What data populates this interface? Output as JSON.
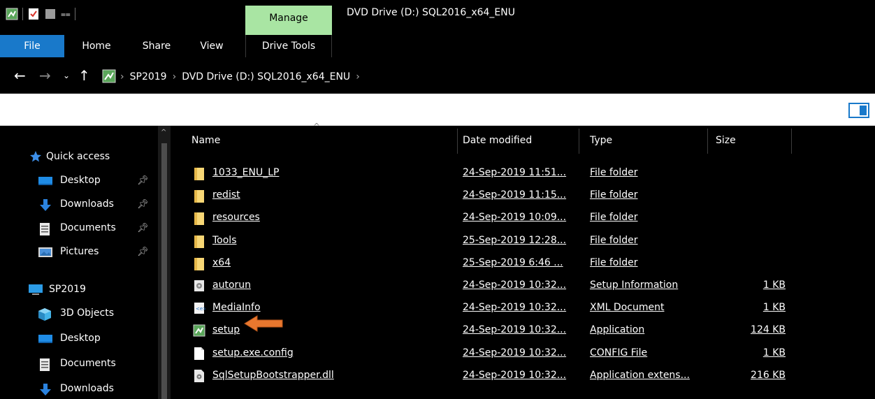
{
  "window": {
    "title": "DVD Drive (D:) SQL2016_x64_ENU",
    "contextual_tab_group": "Manage"
  },
  "ribbon": {
    "tabs": [
      "File",
      "Home",
      "Share",
      "View",
      "Drive Tools"
    ]
  },
  "address": {
    "crumbs": [
      "SP2019",
      "DVD Drive (D:) SQL2016_x64_ENU"
    ]
  },
  "nav_pane": {
    "items": [
      {
        "label": "Quick access",
        "icon": "star-icon"
      },
      {
        "label": "Desktop",
        "icon": "desktop-icon",
        "pinned": true
      },
      {
        "label": "Downloads",
        "icon": "download-icon",
        "pinned": true
      },
      {
        "label": "Documents",
        "icon": "documents-icon",
        "pinned": true
      },
      {
        "label": "Pictures",
        "icon": "pictures-icon",
        "pinned": true
      },
      {
        "label": "SP2019",
        "icon": "computer-icon"
      },
      {
        "label": "3D Objects",
        "icon": "3d-objects-icon"
      },
      {
        "label": "Desktop",
        "icon": "desktop-icon"
      },
      {
        "label": "Documents",
        "icon": "documents-icon"
      },
      {
        "label": "Downloads",
        "icon": "download-icon"
      }
    ]
  },
  "columns": {
    "name": "Name",
    "date": "Date modified",
    "type": "Type",
    "size": "Size"
  },
  "files": [
    {
      "name": "1033_ENU_LP",
      "date": "24-Sep-2019 11:51...",
      "type": "File folder",
      "size": "",
      "icon": "folder-icon"
    },
    {
      "name": "redist",
      "date": "24-Sep-2019 11:15...",
      "type": "File folder",
      "size": "",
      "icon": "folder-icon"
    },
    {
      "name": "resources",
      "date": "24-Sep-2019 10:09...",
      "type": "File folder",
      "size": "",
      "icon": "folder-icon"
    },
    {
      "name": "Tools",
      "date": "25-Sep-2019 12:28...",
      "type": "File folder",
      "size": "",
      "icon": "folder-icon"
    },
    {
      "name": "x64",
      "date": "25-Sep-2019 6:46 ...",
      "type": "File folder",
      "size": "",
      "icon": "folder-icon"
    },
    {
      "name": "autorun",
      "date": "24-Sep-2019 10:32...",
      "type": "Setup Information",
      "size": "1 KB",
      "icon": "setup-info-icon"
    },
    {
      "name": "MediaInfo",
      "date": "24-Sep-2019 10:32...",
      "type": "XML Document",
      "size": "1 KB",
      "icon": "xml-document-icon"
    },
    {
      "name": "setup",
      "date": "24-Sep-2019 10:32...",
      "type": "Application",
      "size": "124 KB",
      "icon": "application-icon"
    },
    {
      "name": "setup.exe.config",
      "date": "24-Sep-2019 10:32...",
      "type": "CONFIG File",
      "size": "1 KB",
      "icon": "file-icon"
    },
    {
      "name": "SqlSetupBootstrapper.dll",
      "date": "24-Sep-2019 10:32...",
      "type": "Application extens...",
      "size": "216 KB",
      "icon": "dll-icon"
    }
  ],
  "colors": {
    "background": "#000000",
    "file_tab": "#1979ca",
    "manage_tab": "#a9e5a3",
    "folder": "#f8d775",
    "callout_arrow": "#e8772e"
  }
}
